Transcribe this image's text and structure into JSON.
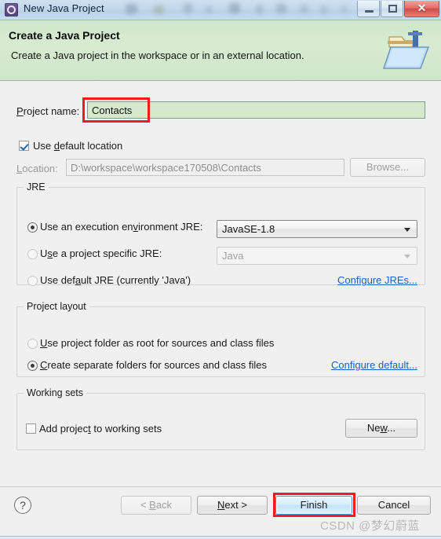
{
  "window": {
    "title": "New Java Project",
    "icon": "java-project-wizard-icon",
    "minimize_label": "",
    "maximize_label": "",
    "close_label": "✕"
  },
  "banner": {
    "title": "Create a Java Project",
    "subtitle": "Create a Java project in the workspace or in an external location.",
    "icon": "java-project-folder-icon"
  },
  "project": {
    "name_label": "Project name:",
    "name_value": "Contacts",
    "use_default_location_label": "Use default location",
    "use_default_location_checked": true,
    "location_label": "Location:",
    "location_value": "D:\\workspace\\workspace170508\\Contacts",
    "browse_label": "Browse..."
  },
  "jre": {
    "group_title": "JRE",
    "options": [
      {
        "label": "Use an execution environment JRE:",
        "selected": true
      },
      {
        "label": "Use a project specific JRE:",
        "selected": false
      },
      {
        "label": "Use default JRE (currently 'Java')",
        "selected": false
      }
    ],
    "execution_env_value": "JavaSE-1.8",
    "specific_jre_value": "Java",
    "configure_link": "Configure JREs..."
  },
  "layout": {
    "group_title": "Project layout",
    "options": [
      {
        "label": "Use project folder as root for sources and class files",
        "selected": false
      },
      {
        "label": "Create separate folders for sources and class files",
        "selected": true
      }
    ],
    "configure_link": "Configure default..."
  },
  "working_sets": {
    "group_title": "Working sets",
    "add_label": "Add project to working sets",
    "add_checked": false,
    "new_label": "New..."
  },
  "footer": {
    "help_label": "?",
    "back_label": "< Back",
    "next_label": "Next >",
    "finish_label": "Finish",
    "cancel_label": "Cancel"
  },
  "annotations": {
    "highlight_color": "#ee1b22",
    "watermark": "CSDN @梦幻蔚蓝"
  }
}
